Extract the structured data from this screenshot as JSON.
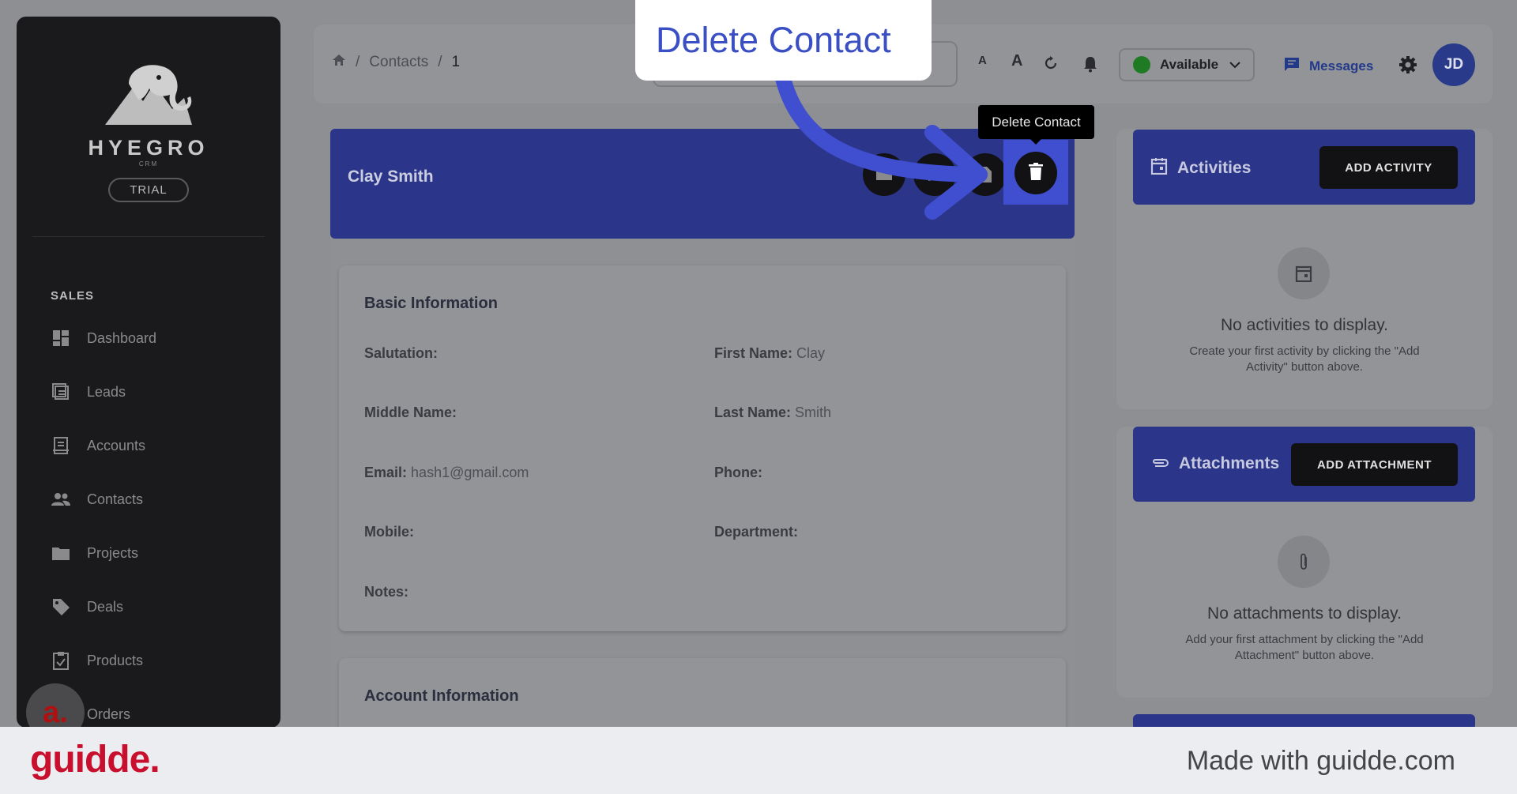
{
  "app": {
    "brand": "HYEGRO",
    "brand_sub": "CRM",
    "plan_badge": "TRIAL"
  },
  "sidebar": {
    "section": "SALES",
    "items": [
      {
        "label": "Dashboard",
        "icon": "dashboard-icon"
      },
      {
        "label": "Leads",
        "icon": "leads-icon"
      },
      {
        "label": "Accounts",
        "icon": "accounts-icon"
      },
      {
        "label": "Contacts",
        "icon": "contacts-icon"
      },
      {
        "label": "Projects",
        "icon": "folder-icon"
      },
      {
        "label": "Deals",
        "icon": "tag-icon"
      },
      {
        "label": "Products",
        "icon": "clipboard-icon"
      },
      {
        "label": "Orders",
        "icon": "cart-icon"
      }
    ],
    "floating_avatar": "a."
  },
  "header": {
    "breadcrumb": [
      "Contacts",
      "1"
    ],
    "font_small": "A",
    "font_large": "A",
    "status": "Available",
    "messages": "Messages",
    "user_initials": "JD"
  },
  "contact": {
    "name": "Clay Smith",
    "tooltip": "Delete Contact",
    "basic_title": "Basic Information",
    "fields": [
      {
        "label": "Salutation:",
        "value": ""
      },
      {
        "label": "First Name:",
        "value": "Clay"
      },
      {
        "label": "Middle Name:",
        "value": ""
      },
      {
        "label": "Last Name:",
        "value": "Smith"
      },
      {
        "label": "Email:",
        "value": "hash1@gmail.com"
      },
      {
        "label": "Phone:",
        "value": ""
      },
      {
        "label": "Mobile:",
        "value": ""
      },
      {
        "label": "Department:",
        "value": ""
      },
      {
        "label": "Notes:",
        "value": ""
      }
    ],
    "account_title": "Account Information"
  },
  "activities": {
    "title": "Activities",
    "button": "ADD ACTIVITY",
    "empty_title": "No activities to display.",
    "empty_sub_1": "Create your first activity by clicking the \"Add",
    "empty_sub_2": "Activity\" button above."
  },
  "attachments": {
    "title": "Attachments",
    "button": "ADD ATTACHMENT",
    "empty_title": "No attachments to display.",
    "empty_sub_1": "Add your first attachment by clicking the \"Add",
    "empty_sub_2": "Attachment\" button above."
  },
  "callout": {
    "text": "Delete Contact"
  },
  "footer": {
    "logo": "guidde.",
    "made_with": "Made with guidde.com"
  },
  "colors": {
    "accent_blue": "#3f4fd0",
    "header_blue": "#2b358a",
    "brand_red": "#c8102e"
  }
}
